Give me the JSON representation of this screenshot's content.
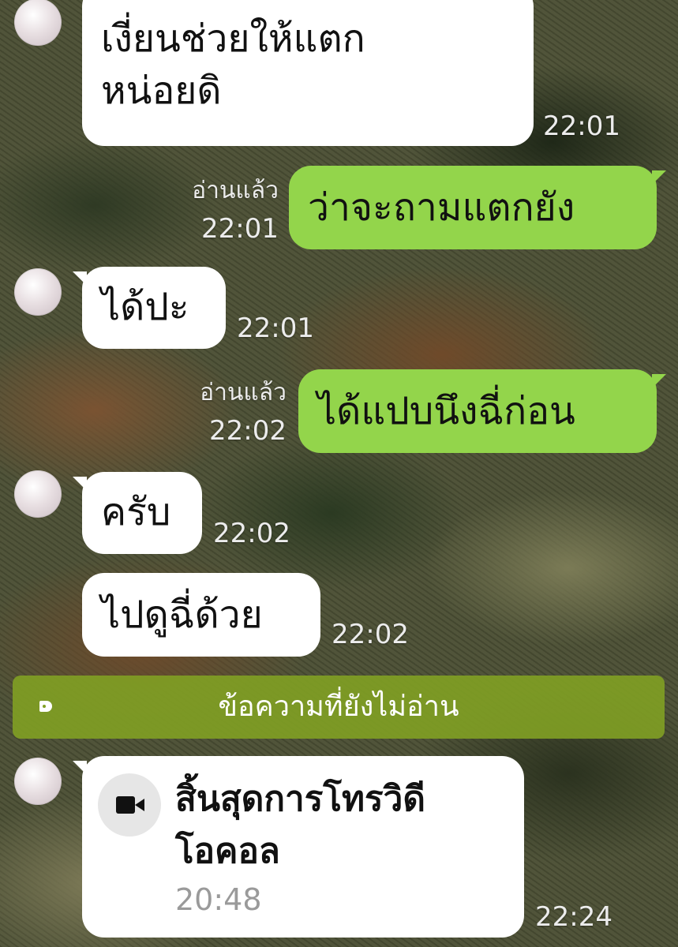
{
  "messages": [
    {
      "sender": "other",
      "text": "เงี่ยนช่วยให้แตก\nหน่อยดิ",
      "time": "22:01"
    },
    {
      "sender": "me",
      "text": "ว่าจะถามแตกยัง",
      "read_label": "อ่านแล้ว",
      "time": "22:01"
    },
    {
      "sender": "other",
      "text": "ได้ปะ",
      "time": "22:01"
    },
    {
      "sender": "me",
      "text": "ได้แปบนึงฉี่ก่อน",
      "read_label": "อ่านแล้ว",
      "time": "22:02"
    },
    {
      "sender": "other",
      "text": "ครับ",
      "time": "22:02"
    },
    {
      "sender": "other",
      "text": "ไปดูฉี่ด้วย",
      "time": "22:02"
    }
  ],
  "unread_divider": {
    "label": "ข้อความที่ยังไม่อ่าน",
    "icon": "tag-icon"
  },
  "call_message": {
    "title": "สิ้นสุดการโทรวิดีโอคอล",
    "duration": "20:48",
    "time": "22:24",
    "icon": "video-camera-icon"
  },
  "colors": {
    "incoming_bubble": "#ffffff",
    "outgoing_bubble": "#93d54b",
    "divider": "#81a024"
  }
}
